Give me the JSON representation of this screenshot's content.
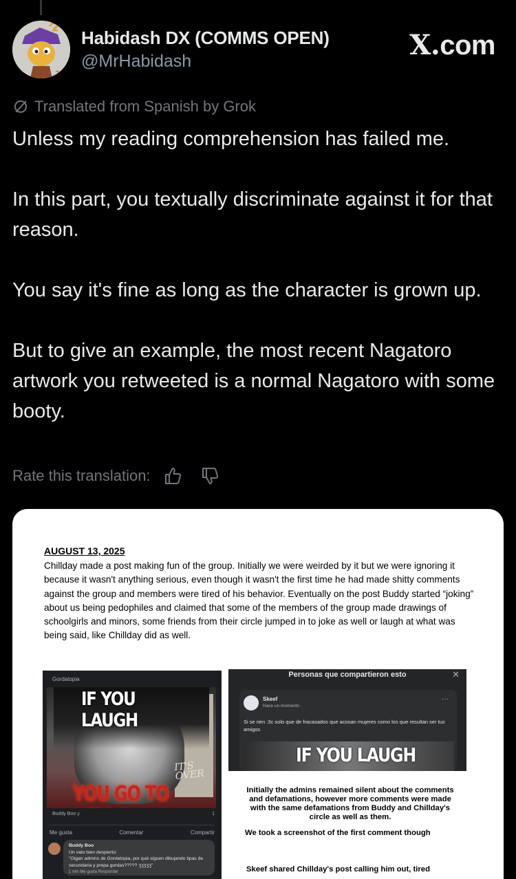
{
  "author": {
    "display_name": "Habidash DX (COMMS OPEN)",
    "handle": "@MrHabidash"
  },
  "watermark": "com",
  "watermark_prefix": "X.",
  "translation": {
    "note": "Translated from Spanish by Grok",
    "rate_label": "Rate this translation:",
    "icons": [
      "thumbs-up-icon",
      "thumbs-down-icon"
    ]
  },
  "tweet": {
    "paragraphs": [
      "Unless my reading comprehension has failed me.",
      "In this part, you textually discriminate against it for that reason.",
      "You say it's fine as long as the character is grown up.",
      "But to give an example, the most recent Nagatoro artwork you retweeted is a normal Nagatoro with some booty."
    ]
  },
  "document": {
    "date": "AUGUST 13, 2025",
    "paragraph": "Chillday made a post making fun of the group. Initially we were weirded by it but we were ignoring it because it wasn't anything serious, even though it wasn't the first time he had made shitty comments against the group and members were tired of his behavior. Eventually on the post Buddy started “joking” about us being pedophiles and claimed that some of the members of the group made drawings of schoolgirls and minors, some friends from their circle jumped in to joke as well or laugh at what was being said, like Chillday did as well.",
    "left_screenshot": {
      "group": "Gordatopia",
      "meme_top": "IF YOU LAUGH",
      "meme_side": "IT'S OVER",
      "meme_bottom": "YOU GO TO HELL",
      "reactions": "Buddy Boo y",
      "comment_count": "1",
      "actions": [
        "Me gusta",
        "Comentar",
        "Compartir"
      ],
      "comment_name": "Buddy Boo",
      "comment_line1": "Un vato bien despierto:",
      "comment_line2": "\"Oigan admins de Gordatopia, por qué siguen dibujando tipas de secundaria y prepa gordas????? ʒʒʒʒʒ\"",
      "comment_meta": "1 min   Me gusta   Responder"
    },
    "right_screenshot": {
      "title": "Personas que compartieron esto",
      "close": "✕",
      "poster": "Skeef",
      "time": "Hace un momento ·",
      "text": "Si se rien :3c solo que de fracasados que acosan mujeres como los que resultan ser tus amigos",
      "meme_top": "IF YOU LAUGH"
    },
    "note1": "Initially the admins remained silent about the comments and defamations, however more comments were made with the same defamations from Buddy and Chillday's circle as well as them.",
    "note2": "We took a screenshot of the first comment though",
    "note3": "Skeef shared Chillday's post calling him out, tired"
  },
  "colors": {
    "background": "#000000",
    "text": "#e7e9ea",
    "muted": "#71767b",
    "handle": "#8b98a5"
  }
}
